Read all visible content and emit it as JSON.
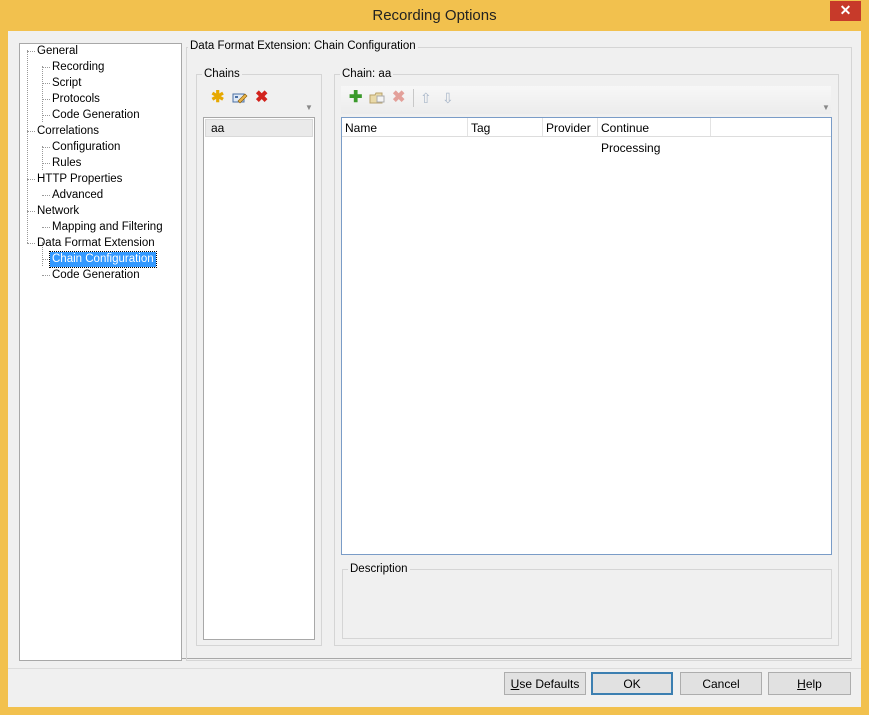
{
  "window": {
    "title": "Recording Options",
    "close_glyph": "✕"
  },
  "tree": {
    "items": [
      {
        "label": "General"
      },
      {
        "label": "Recording"
      },
      {
        "label": "Script"
      },
      {
        "label": "Protocols"
      },
      {
        "label": "Code Generation"
      },
      {
        "label": "Correlations"
      },
      {
        "label": "Configuration"
      },
      {
        "label": "Rules"
      },
      {
        "label": "HTTP Properties"
      },
      {
        "label": "Advanced"
      },
      {
        "label": "Network"
      },
      {
        "label": "Mapping and Filtering"
      },
      {
        "label": "Data Format Extension"
      },
      {
        "label": "Chain Configuration"
      },
      {
        "label": "Code Generation"
      }
    ],
    "selected": "Chain Configuration"
  },
  "main": {
    "group_title": "Data Format Extension: Chain Configuration",
    "chains": {
      "title": "Chains",
      "items": [
        "aa"
      ],
      "toolbar": {
        "add_icon": "asterisk-icon",
        "edit_icon": "edit-icon",
        "delete_icon": "delete-icon"
      }
    },
    "chain": {
      "title": "Chain: aa",
      "columns": [
        "Name",
        "Tag",
        "Provider",
        "Continue Processing"
      ],
      "toolbar": {
        "add": "plus-icon",
        "import": "folder-icon",
        "delete": "delete-icon",
        "up": "arrow-up-icon",
        "down": "arrow-down-icon"
      },
      "description_title": "Description"
    }
  },
  "buttons": {
    "use_defaults_u": "U",
    "use_defaults_rest": "se Defaults",
    "ok": "OK",
    "cancel": "Cancel",
    "help_u": "H",
    "help_rest": "elp"
  }
}
